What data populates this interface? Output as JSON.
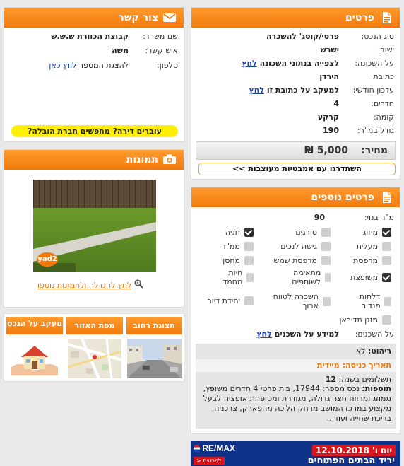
{
  "details": {
    "title": "פרטים",
    "rows": [
      {
        "label": "סוג הנכס:",
        "value": "פרטי/קוטג' להשכרה"
      },
      {
        "label": "ישוב:",
        "value": "ישרש"
      },
      {
        "label": "על השכונה:",
        "value": "לצפייה בנתוני השכונה",
        "link": "לחץ"
      },
      {
        "label": "כתובת:",
        "value": "הירדן"
      },
      {
        "label": "עדכון חודשי:",
        "value": "למעקב על כתובת זו",
        "link": "לחץ"
      },
      {
        "label": "חדרים:",
        "value": "4"
      },
      {
        "label": "קומה:",
        "value": "קרקע"
      },
      {
        "label": "גודל במ\"ר:",
        "value": "190"
      }
    ],
    "price_label": "מחיר:",
    "price_value": "5,000 ₪",
    "promo_link": "השתדרגו עם אמבטיות מעוצבות >>"
  },
  "more": {
    "title": "פרטים נוספים",
    "built_label": "מ\"ר בנוי:",
    "built_value": "90",
    "features": [
      {
        "label": "מיזוג",
        "checked": true
      },
      {
        "label": "סורגים",
        "checked": false
      },
      {
        "label": "חניה",
        "checked": true
      },
      {
        "label": "מעלית",
        "checked": false
      },
      {
        "label": "גישה לנכים",
        "checked": false
      },
      {
        "label": "ממ\"ד",
        "checked": false
      },
      {
        "label": "מרפסת",
        "checked": false
      },
      {
        "label": "מרפסת שמש",
        "checked": false
      },
      {
        "label": "מחסן",
        "checked": false
      },
      {
        "label": "משופצת",
        "checked": true
      },
      {
        "label": "מתאימה לשותפים",
        "checked": false
      },
      {
        "label": "חיות מחמד",
        "checked": false
      },
      {
        "label": "דלתות פנדור",
        "checked": false
      },
      {
        "label": "השכרה לטווח ארוך",
        "checked": false
      },
      {
        "label": "יחידת דיור",
        "checked": false
      },
      {
        "label": "מזגן תדיראן",
        "checked": false
      }
    ],
    "neighbors_label": "על השכנים:",
    "neighbors_value": "למידע על השכנים",
    "neighbors_link": "לחץ"
  },
  "extra": {
    "furniture_label": "ריהוט:",
    "furniture_value": "לא",
    "entry": "תאריך כניסה: מיידית",
    "payments_label": "תשלומים בשנה:",
    "payments_value": "12",
    "additions_label": "תוספות:",
    "additions_text": "נכס מספר: 17944, בית פרטי 4 חדרים משופץ, ממוזג ומרווח חצר גדולה, מגודרת ומטופחת אופציה לבעל מקצוע במרכז המושב מרחק הליכה מהפארק, צרכניה, בריכת שחייה ועוד .."
  },
  "banner": {
    "date": "יום ו' 12.10.2018",
    "event": "יריד הבתים הפתוחים",
    "brand": "RE/MAX",
    "cta": "לפרטים <"
  },
  "contact": {
    "title": "צור קשר",
    "rows": [
      {
        "label": "שם משרד:",
        "value": "קבוצת הכוורת ש.ש.ש"
      },
      {
        "label": "איש קשר:",
        "value": "משה"
      }
    ],
    "phone_label": "טלפון:",
    "phone_text": "להצגת המספר",
    "phone_link": "לחץ כאן",
    "moving_text": "עוברים דירה? מחפשים חברת הובלה?"
  },
  "photos": {
    "title": "תמונות",
    "watermark": "yad2",
    "enlarge_link": "לחץ להגדלה ולתמונות נוספו"
  },
  "tabs": [
    {
      "label": "תצוגת רחוב"
    },
    {
      "label": "מפת האזור"
    },
    {
      "label": "מעקב על הנכס"
    }
  ],
  "colors": {
    "accent": "#f27a0c",
    "link": "#1a3fb0",
    "yellow": "#ffef00"
  }
}
